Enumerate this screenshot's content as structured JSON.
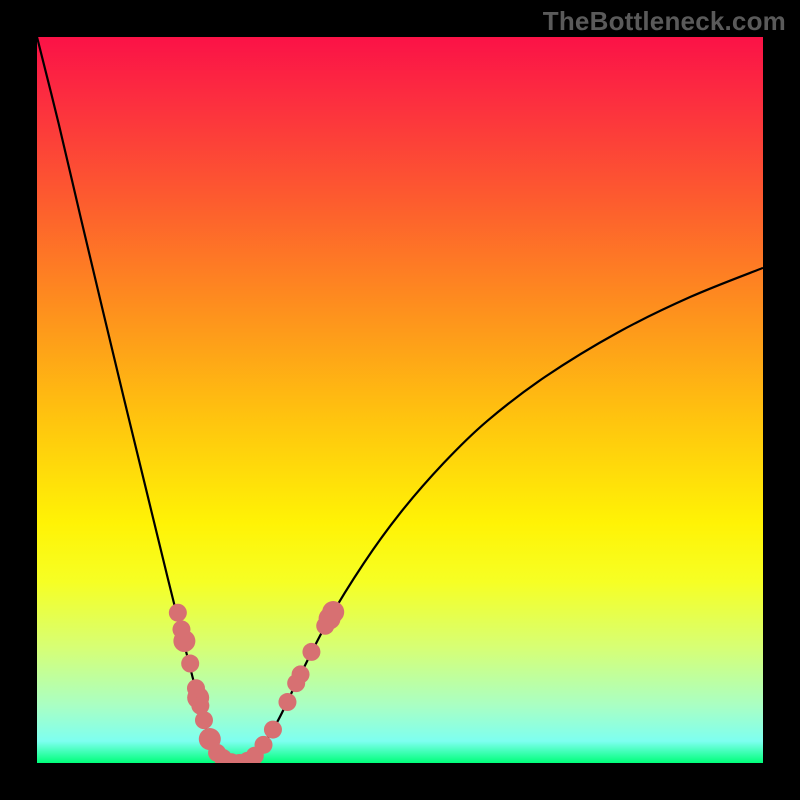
{
  "watermark": "TheBottleneck.com",
  "chart_data": {
    "type": "line",
    "title": "",
    "xlabel": "",
    "ylabel": "",
    "xlim": [
      0,
      1
    ],
    "ylim": [
      0,
      100
    ],
    "series": [
      {
        "name": "curve",
        "x": [
          0.0,
          0.03,
          0.06,
          0.09,
          0.12,
          0.15,
          0.18,
          0.21,
          0.225,
          0.24,
          0.26,
          0.28,
          0.3,
          0.33,
          0.36,
          0.4,
          0.45,
          0.5,
          0.56,
          0.62,
          0.7,
          0.8,
          0.9,
          1.0
        ],
        "values": [
          100.0,
          88.0,
          75.2,
          62.6,
          50.1,
          37.8,
          25.5,
          13.5,
          7.8,
          2.6,
          0.7,
          0.0,
          1.0,
          5.5,
          11.6,
          19.4,
          27.5,
          34.4,
          41.3,
          47.1,
          53.2,
          59.3,
          64.2,
          68.2
        ]
      }
    ],
    "markers": [
      {
        "x": 0.194,
        "y": 20.7,
        "r": 9
      },
      {
        "x": 0.199,
        "y": 18.4,
        "r": 9
      },
      {
        "x": 0.203,
        "y": 16.8,
        "r": 11
      },
      {
        "x": 0.211,
        "y": 13.7,
        "r": 9
      },
      {
        "x": 0.219,
        "y": 10.3,
        "r": 9
      },
      {
        "x": 0.222,
        "y": 9.0,
        "r": 11
      },
      {
        "x": 0.225,
        "y": 7.9,
        "r": 9
      },
      {
        "x": 0.23,
        "y": 5.9,
        "r": 9
      },
      {
        "x": 0.238,
        "y": 3.3,
        "r": 11
      },
      {
        "x": 0.248,
        "y": 1.4,
        "r": 9
      },
      {
        "x": 0.256,
        "y": 0.7,
        "r": 9
      },
      {
        "x": 0.268,
        "y": 0.1,
        "r": 9
      },
      {
        "x": 0.279,
        "y": 0.0,
        "r": 9
      },
      {
        "x": 0.29,
        "y": 0.3,
        "r": 9
      },
      {
        "x": 0.3,
        "y": 1.0,
        "r": 9
      },
      {
        "x": 0.312,
        "y": 2.5,
        "r": 9
      },
      {
        "x": 0.325,
        "y": 4.6,
        "r": 9
      },
      {
        "x": 0.345,
        "y": 8.4,
        "r": 9
      },
      {
        "x": 0.357,
        "y": 11.0,
        "r": 9
      },
      {
        "x": 0.363,
        "y": 12.2,
        "r": 9
      },
      {
        "x": 0.378,
        "y": 15.3,
        "r": 9
      },
      {
        "x": 0.397,
        "y": 18.9,
        "r": 9
      },
      {
        "x": 0.403,
        "y": 19.9,
        "r": 11
      },
      {
        "x": 0.408,
        "y": 20.8,
        "r": 11
      }
    ],
    "marker_color": "#d77072",
    "curve_color": "#000000",
    "gradient_stops": [
      {
        "pos": 0.0,
        "color": "#fb1247"
      },
      {
        "pos": 0.09,
        "color": "#fc2f3f"
      },
      {
        "pos": 0.22,
        "color": "#fd5a2f"
      },
      {
        "pos": 0.37,
        "color": "#fe8e1e"
      },
      {
        "pos": 0.52,
        "color": "#ffc20f"
      },
      {
        "pos": 0.67,
        "color": "#fff305"
      },
      {
        "pos": 0.75,
        "color": "#f6ff24"
      },
      {
        "pos": 0.84,
        "color": "#d7ff74"
      },
      {
        "pos": 0.92,
        "color": "#aaffc3"
      },
      {
        "pos": 0.97,
        "color": "#7efff0"
      },
      {
        "pos": 1.0,
        "color": "#00ff7a"
      }
    ]
  }
}
